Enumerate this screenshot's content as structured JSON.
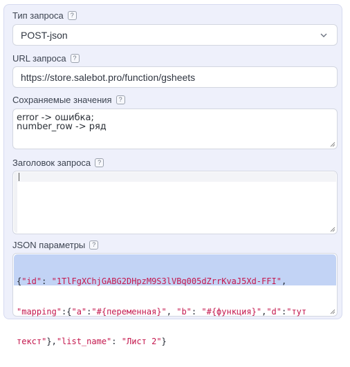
{
  "request_type": {
    "label": "Тип запроса",
    "help": "?",
    "value": "POST-json"
  },
  "url": {
    "label": "URL запроса",
    "help": "?",
    "value": "https://store.salebot.pro/function/gsheets"
  },
  "saved_values": {
    "label": "Сохраняемые значения",
    "help": "?",
    "value": "error -> ошибка;\nnumber_row -> ряд"
  },
  "request_header": {
    "label": "Заголовок запроса",
    "help": "?",
    "value": ""
  },
  "json_params": {
    "label": "JSON параметры",
    "help": "?",
    "line1": [
      {
        "t": "{",
        "k": "punc"
      },
      {
        "t": "\"id\"",
        "k": "str"
      },
      {
        "t": ": ",
        "k": "punc"
      },
      {
        "t": "\"1TlFgXChjGABG2DHpzM9S3lVBq005dZrrKvaJ5Xd-FFI\"",
        "k": "str"
      },
      {
        "t": ",",
        "k": "punc"
      }
    ],
    "line2": [
      {
        "t": "\"mapping\"",
        "k": "str"
      },
      {
        "t": ":{",
        "k": "punc"
      },
      {
        "t": "\"a\"",
        "k": "str"
      },
      {
        "t": ":",
        "k": "punc"
      },
      {
        "t": "\"#{переменная}\"",
        "k": "str"
      },
      {
        "t": ", ",
        "k": "punc"
      },
      {
        "t": "\"b\"",
        "k": "str"
      },
      {
        "t": ": ",
        "k": "punc"
      },
      {
        "t": "\"#{функция}\"",
        "k": "str"
      },
      {
        "t": ",",
        "k": "punc"
      },
      {
        "t": "\"d\"",
        "k": "str"
      },
      {
        "t": ":",
        "k": "punc"
      },
      {
        "t": "\"тут",
        "k": "str"
      }
    ],
    "line3": [
      {
        "t": "текст\"",
        "k": "str"
      },
      {
        "t": "},",
        "k": "punc"
      },
      {
        "t": "\"list_name\"",
        "k": "str"
      },
      {
        "t": ": ",
        "k": "punc"
      },
      {
        "t": "\"Лист 2\"",
        "k": "str"
      },
      {
        "t": "}",
        "k": "punc"
      }
    ]
  },
  "icons": {
    "select_chevron": "chevron-down-icon",
    "resize_handle": "resize-handle-icon",
    "help": "help-icon"
  },
  "colors": {
    "panel_bg": "#eef0fb",
    "json_highlight": "#c2d3f5",
    "json_string": "#c4174d"
  }
}
